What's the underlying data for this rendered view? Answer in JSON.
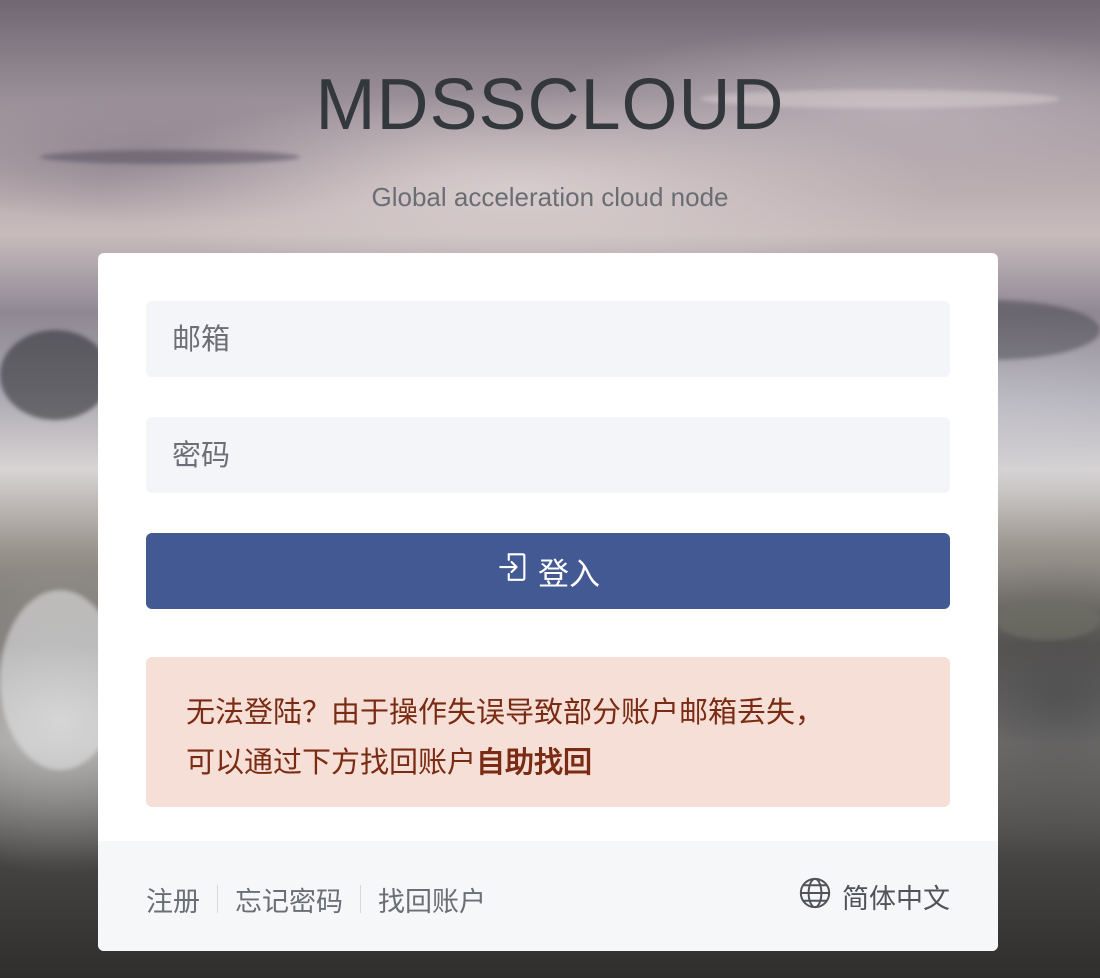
{
  "brand": {
    "title": "MDSSCLOUD",
    "tagline": "Global acceleration cloud node"
  },
  "login_form": {
    "email_placeholder": "邮箱",
    "password_placeholder": "密码",
    "login_button_label": "登入",
    "login_icon": "sign-in-icon"
  },
  "notice": {
    "line1": "无法登陆？由于操作失误导致部分账户邮箱丢失，",
    "line2_text": "可以通过下方找回账户",
    "line2_link": "自助找回"
  },
  "footer": {
    "links": [
      "注册",
      "忘记密码",
      "找回账户"
    ],
    "language_label": "简体中文",
    "language_icon": "globe-icon"
  },
  "colors": {
    "primary_button": "#425993",
    "notice_background": "#f6dfd6",
    "notice_text": "#7a2b14",
    "input_background": "#f4f5f9"
  }
}
